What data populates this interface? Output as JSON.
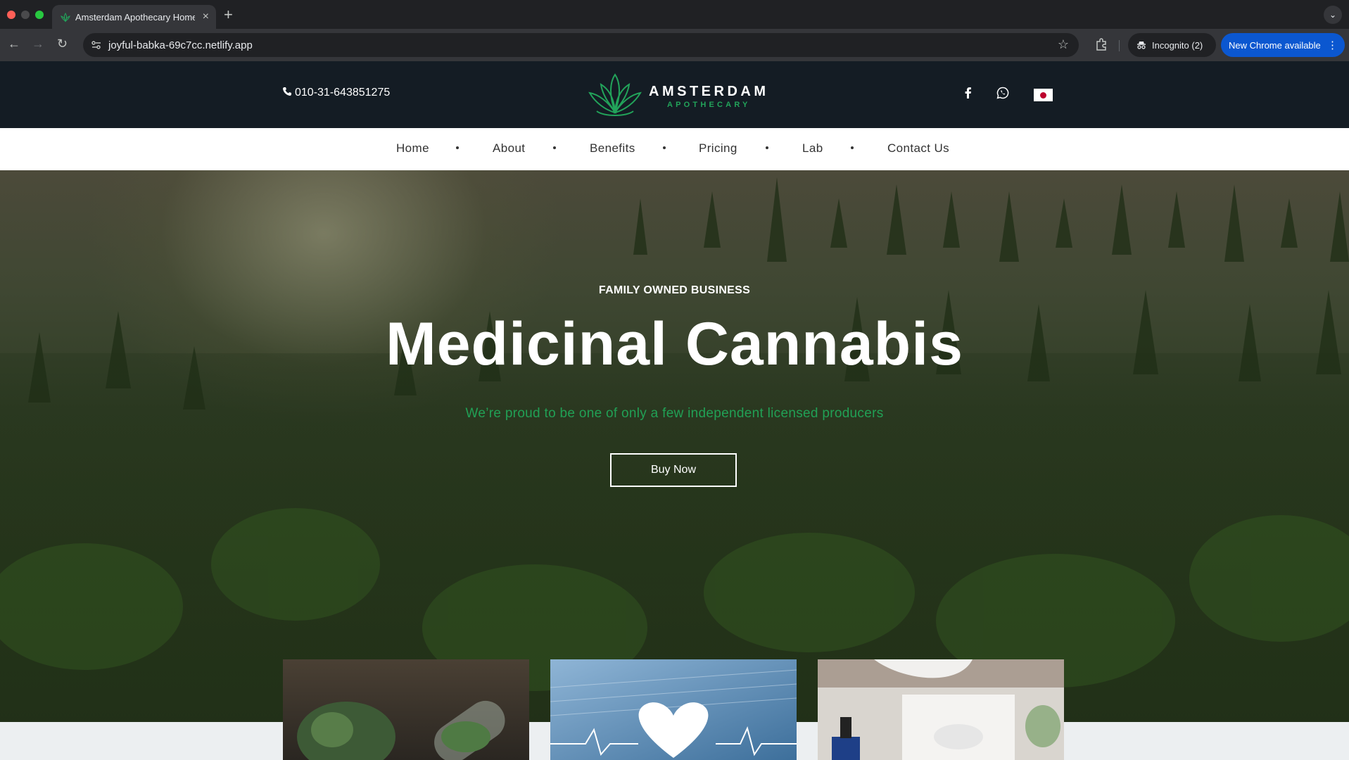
{
  "browser": {
    "tab_title": "Amsterdam Apothecary Home",
    "tab_close": "×",
    "new_tab": "+",
    "tab_menu": "⌄",
    "url": "joyful-babka-69c7cc.netlify.app",
    "incognito_label": "Incognito (2)",
    "update_label": "New Chrome available",
    "update_menu": "⋮",
    "back": "←",
    "forward": "→",
    "reload": "↻",
    "bookmark": "☆"
  },
  "site": {
    "phone": "010-31-643851275",
    "brand_name": "AMSTERDAM",
    "brand_sub": "APOTHECARY",
    "brand_color": "#22a35a",
    "nav": [
      {
        "label": "Home"
      },
      {
        "label": "About"
      },
      {
        "label": "Benefits"
      },
      {
        "label": "Pricing"
      },
      {
        "label": "Lab"
      },
      {
        "label": "Contact Us"
      }
    ],
    "social_icons": [
      "facebook-icon",
      "whatsapp-icon",
      "japan-flag-icon"
    ]
  },
  "hero": {
    "eyebrow": "FAMILY OWNED BUSINESS",
    "title": "Medicinal Cannabis",
    "subtitle": "We’re proud to be one of only a few independent licensed producers",
    "button": "Buy Now"
  },
  "cards": [
    {
      "image": "cannabis-buds-capsule-photo"
    },
    {
      "image": "heart-stethoscope-keyboard-photo"
    },
    {
      "image": "doctor-dropper-bottle-photo"
    }
  ]
}
